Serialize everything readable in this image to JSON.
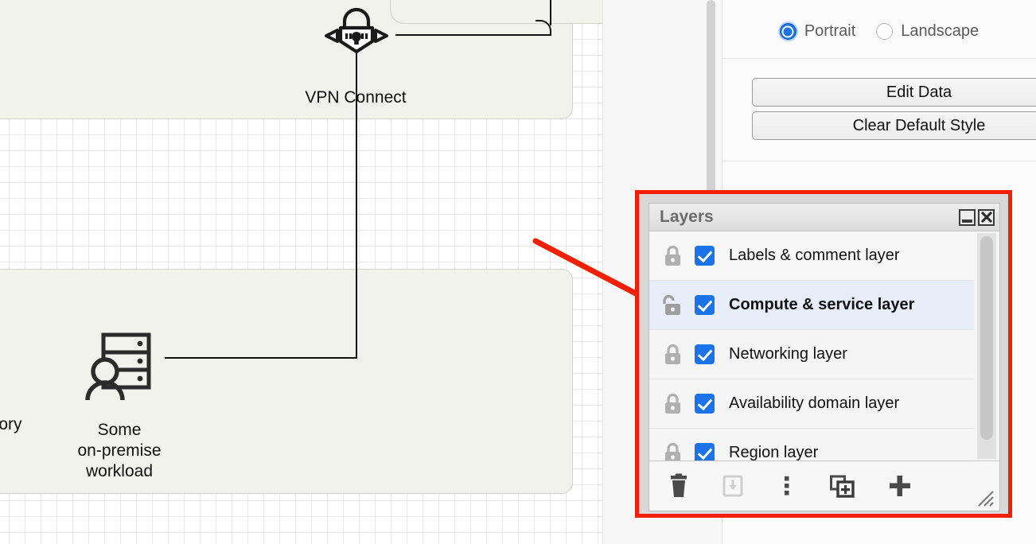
{
  "canvas": {
    "nodes": [
      {
        "id": "vpn",
        "icon": "vpn-lock-icon",
        "label": "VPN Connect"
      },
      {
        "id": "onprem",
        "icon": "server-user-icon",
        "label": "Some\non-premise\nworkload"
      }
    ],
    "clipped_label": "ctory"
  },
  "format_panel": {
    "orientation": {
      "options": [
        {
          "label": "Portrait",
          "checked": true
        },
        {
          "label": "Landscape",
          "checked": false
        }
      ]
    },
    "buttons": [
      {
        "label": "Edit Data"
      },
      {
        "label": "Clear Default Style"
      }
    ]
  },
  "layers_window": {
    "title": "Layers",
    "window_buttons": [
      {
        "name": "minimize-button",
        "glyph": "minimize-icon"
      },
      {
        "name": "close-button",
        "glyph": "close-icon"
      }
    ],
    "rows": [
      {
        "name": "Labels & comment layer",
        "locked": true,
        "visible": true,
        "selected": false
      },
      {
        "name": "Compute & service layer",
        "locked": false,
        "visible": true,
        "selected": true
      },
      {
        "name": "Networking layer",
        "locked": true,
        "visible": true,
        "selected": false
      },
      {
        "name": "Availability domain layer",
        "locked": true,
        "visible": true,
        "selected": false
      },
      {
        "name": "Region layer",
        "locked": true,
        "visible": true,
        "selected": false
      }
    ],
    "toolbar": [
      {
        "name": "delete-layer-button",
        "icon": "trash-icon",
        "enabled": true
      },
      {
        "name": "move-selection-to-button",
        "icon": "move-to-tray-icon",
        "enabled": false
      },
      {
        "name": "layer-options-button",
        "icon": "kebab-menu-icon",
        "enabled": true
      },
      {
        "name": "duplicate-layer-button",
        "icon": "duplicate-plus-icon",
        "enabled": true
      },
      {
        "name": "add-layer-button",
        "icon": "plus-icon",
        "enabled": true
      }
    ]
  },
  "annotation": {
    "arrow_color": "#f22000",
    "highlight_color": "#f22000"
  },
  "colors": {
    "accent_blue": "#1a73e8",
    "annotation_red": "#f22000",
    "selected_row": "#e7eefa",
    "shape_fill": "#f2f2ed"
  }
}
